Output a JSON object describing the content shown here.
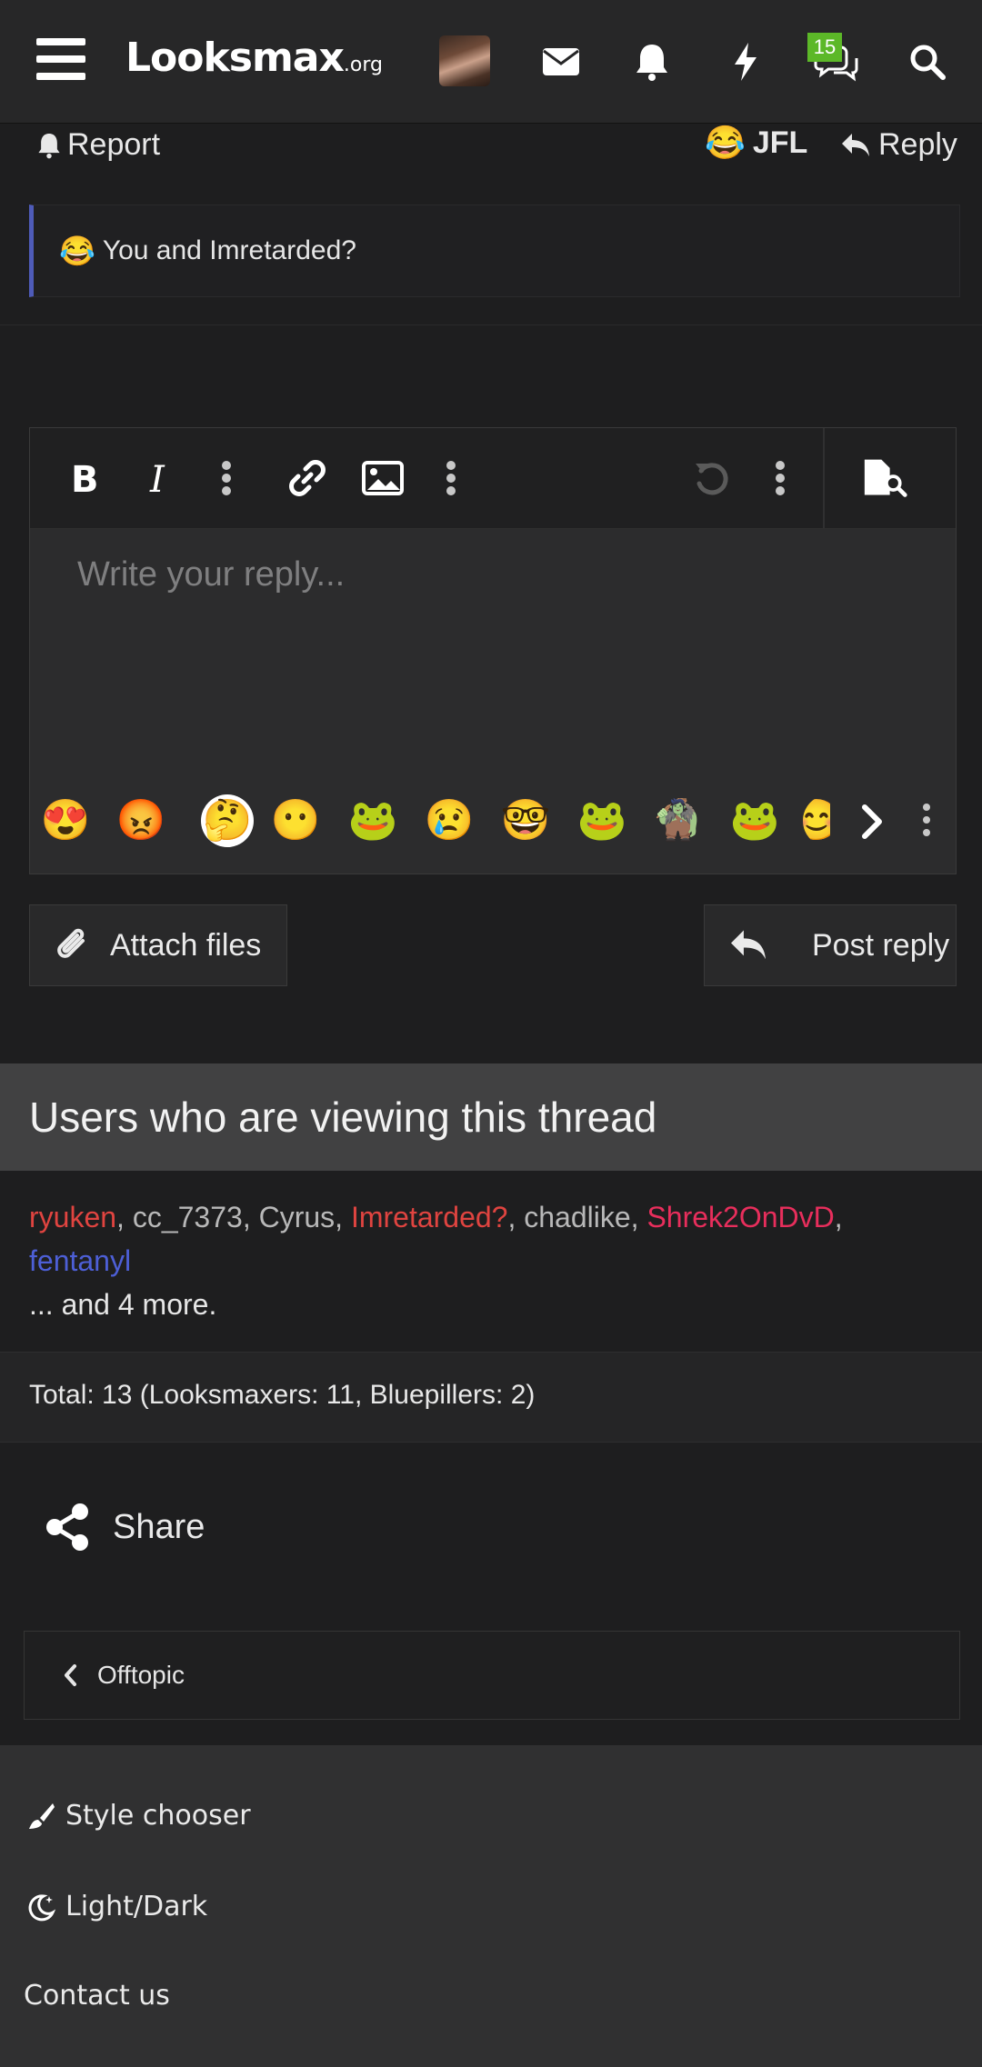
{
  "header": {
    "logo_main": "Looksmax",
    "logo_suffix": ".org",
    "conversations_badge": "15",
    "icons": [
      "menu-icon",
      "envelope-icon",
      "bell-icon",
      "bolt-icon",
      "comments-icon",
      "search-icon"
    ]
  },
  "post_actions": {
    "report_label": "Report",
    "reaction_label": "JFL",
    "reply_label": "Reply"
  },
  "quote": {
    "text": "You and Imretarded?"
  },
  "editor": {
    "placeholder": "Write your reply...",
    "toolbar": [
      "bold-icon",
      "italic-icon",
      "more-icon",
      "link-icon",
      "image-icon",
      "more-icon",
      "undo-icon",
      "more-icon",
      "preview-icon"
    ],
    "emoji_bar": [
      "😍",
      "😡",
      "🤔",
      "😶",
      "🐸",
      "😢",
      "🤓",
      "🐸",
      "🧌",
      "🐸",
      "😊"
    ]
  },
  "buttons": {
    "attach_label": "Attach files",
    "post_reply_label": "Post reply"
  },
  "viewing": {
    "title": "Users who are viewing this thread",
    "users": [
      {
        "name": "ryuken",
        "color": "#e04440"
      },
      {
        "name": "cc_7373",
        "color": "#b8b8b8"
      },
      {
        "name": "Cyrus",
        "color": "#b8b8b8"
      },
      {
        "name": "Imretarded?",
        "color": "#e04440"
      },
      {
        "name": "chadlike",
        "color": "#b8b8b8"
      },
      {
        "name": "Shrek2OnDvD",
        "color": "#e82e5c"
      },
      {
        "name": "fentanyl",
        "color": "#4d5fd6"
      }
    ],
    "more_text": "... and 4 more.",
    "total_text": "Total: 13 (Looksmaxers: 11, Bluepillers: 2)"
  },
  "share_label": "Share",
  "breadcrumb_label": "Offtopic",
  "footer": {
    "style_chooser": "Style chooser",
    "light_dark": "Light/Dark",
    "contact": "Contact us"
  }
}
